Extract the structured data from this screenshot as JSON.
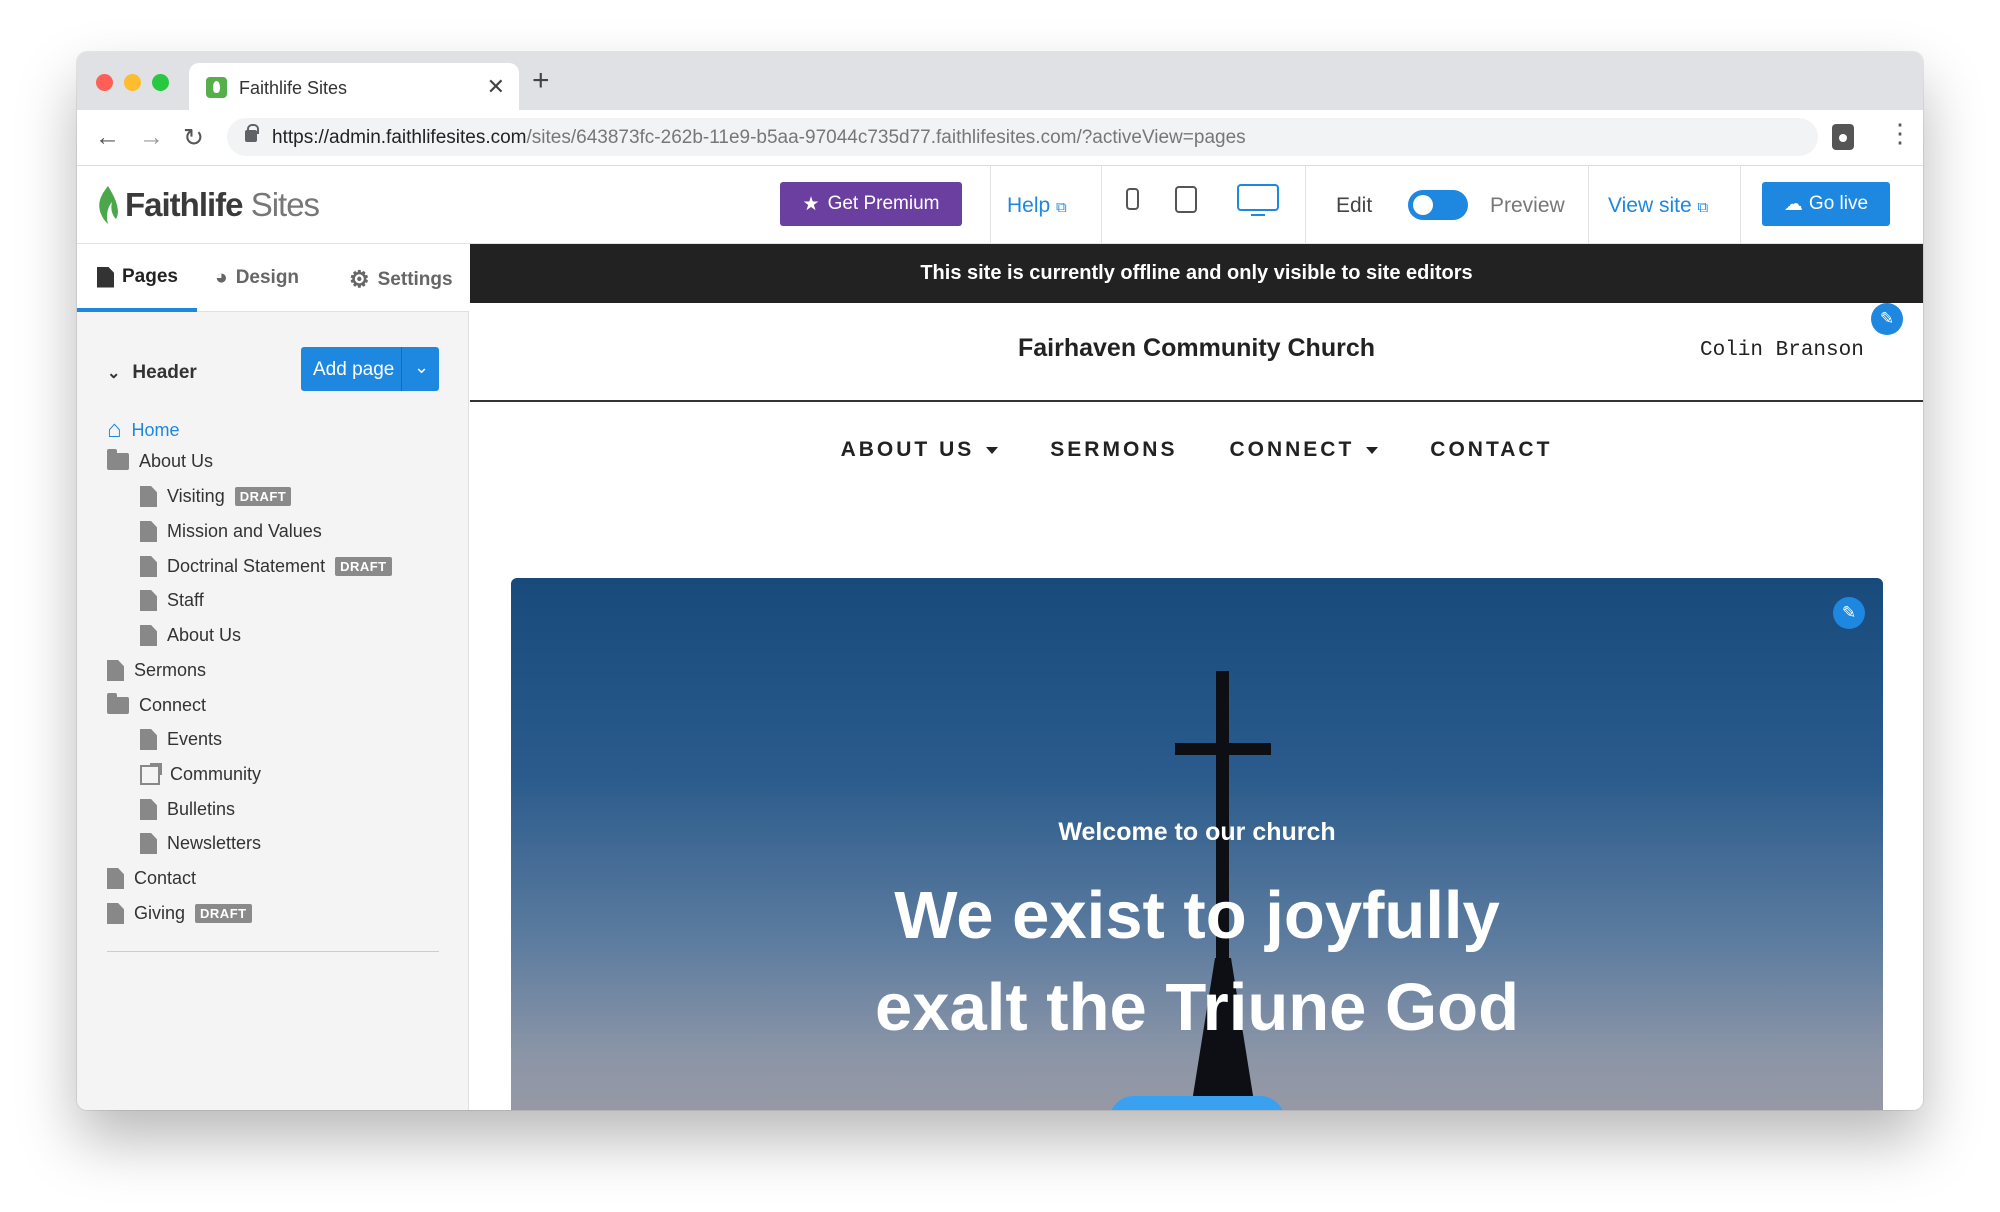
{
  "browser": {
    "tab_title": "Faithlife Sites",
    "url_host": "https://admin.faithlifesites.com",
    "url_path": "/sites/643873fc-262b-11e9-b5aa-97044c735d77.faithlifesites.com/?activeView=pages"
  },
  "app": {
    "logo_brand": "Faithlife",
    "logo_product": "Sites",
    "premium_label": "Get Premium",
    "help_label": "Help",
    "edit_label": "Edit",
    "preview_label": "Preview",
    "view_site_label": "View site",
    "go_live_label": "Go live",
    "accent_color": "#1e87e0",
    "premium_color": "#6b3fa0"
  },
  "sidebar": {
    "tabs": [
      {
        "label": "Pages",
        "icon": "page-icon",
        "active": true
      },
      {
        "label": "Design",
        "icon": "palette-icon",
        "active": false
      },
      {
        "label": "Settings",
        "icon": "gear-icon",
        "active": false
      }
    ],
    "section_label": "Header",
    "add_page_label": "Add page",
    "draft_label": "DRAFT",
    "items": [
      {
        "label": "Home",
        "type": "home",
        "level": 0
      },
      {
        "label": "About Us",
        "type": "folder",
        "level": 0
      },
      {
        "label": "Visiting",
        "type": "page",
        "level": 1,
        "draft": true
      },
      {
        "label": "Mission and Values",
        "type": "page",
        "level": 1
      },
      {
        "label": "Doctrinal Statement",
        "type": "page",
        "level": 1,
        "draft": true
      },
      {
        "label": "Staff",
        "type": "page",
        "level": 1
      },
      {
        "label": "About Us",
        "type": "page",
        "level": 1
      },
      {
        "label": "Sermons",
        "type": "page",
        "level": 0
      },
      {
        "label": "Connect",
        "type": "folder",
        "level": 0
      },
      {
        "label": "Events",
        "type": "page",
        "level": 1
      },
      {
        "label": "Community",
        "type": "external",
        "level": 1
      },
      {
        "label": "Bulletins",
        "type": "page",
        "level": 1
      },
      {
        "label": "Newsletters",
        "type": "page",
        "level": 1
      },
      {
        "label": "Contact",
        "type": "page",
        "level": 0
      },
      {
        "label": "Giving",
        "type": "page",
        "level": 0,
        "draft": true
      }
    ]
  },
  "site": {
    "offline_banner": "This site is currently offline and only visible to site editors",
    "church_name": "Fairhaven Community Church",
    "user_name": "Colin Branson",
    "nav": [
      {
        "label": "ABOUT US",
        "dropdown": true
      },
      {
        "label": "SERMONS",
        "dropdown": false
      },
      {
        "label": "CONNECT",
        "dropdown": true
      },
      {
        "label": "CONTACT",
        "dropdown": false
      }
    ],
    "hero": {
      "welcome": "Welcome to our church",
      "headline_line1": "We exist to joyfully",
      "headline_line2": "exalt the Triune God"
    }
  }
}
